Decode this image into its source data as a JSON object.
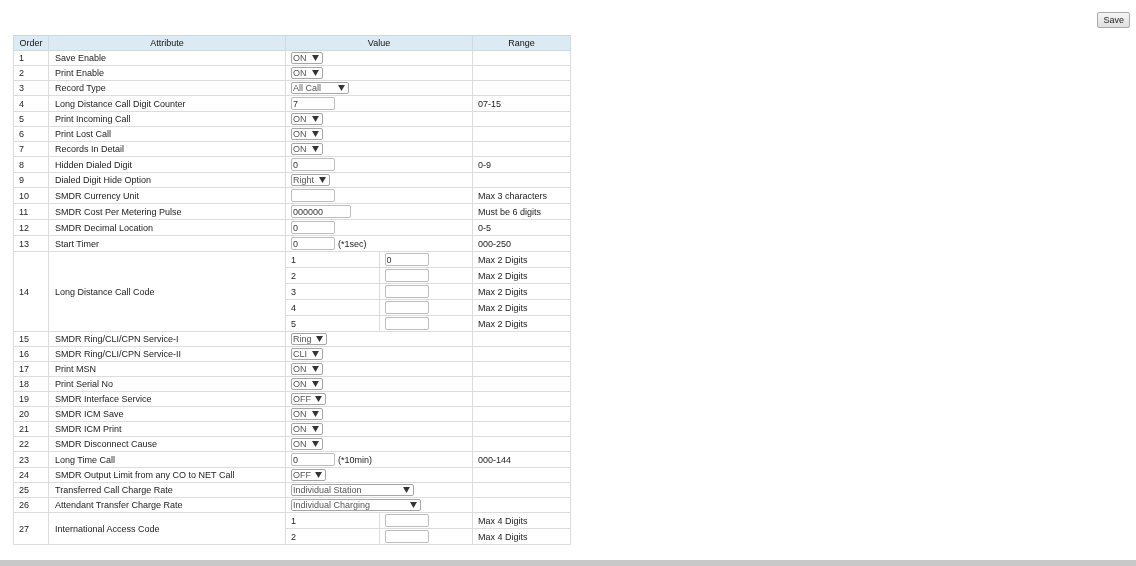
{
  "save_button": "Save",
  "columns": [
    "Order",
    "Attribute",
    "Value",
    "Range"
  ],
  "rows": [
    {
      "order": "1",
      "attribute": "Save Enable",
      "kind": "select",
      "value": "ON"
    },
    {
      "order": "2",
      "attribute": "Print Enable",
      "kind": "select",
      "value": "ON"
    },
    {
      "order": "3",
      "attribute": "Record Type",
      "kind": "select",
      "value": "All Call"
    },
    {
      "order": "4",
      "attribute": "Long Distance Call Digit Counter",
      "kind": "input",
      "value": "7",
      "range": "07-15"
    },
    {
      "order": "5",
      "attribute": "Print Incoming Call",
      "kind": "select",
      "value": "ON"
    },
    {
      "order": "6",
      "attribute": "Print Lost Call",
      "kind": "select",
      "value": "ON"
    },
    {
      "order": "7",
      "attribute": "Records In Detail",
      "kind": "select",
      "value": "ON"
    },
    {
      "order": "8",
      "attribute": "Hidden Dialed Digit",
      "kind": "input",
      "value": "0",
      "range": "0-9"
    },
    {
      "order": "9",
      "attribute": "Dialed Digit Hide Option",
      "kind": "select",
      "value": "Right"
    },
    {
      "order": "10",
      "attribute": "SMDR Currency Unit",
      "kind": "input",
      "range": "Max 3 characters"
    },
    {
      "order": "11",
      "attribute": "SMDR Cost Per Metering Pulse",
      "kind": "input",
      "value": "000000",
      "range": "Must be 6 digits"
    },
    {
      "order": "12",
      "attribute": "SMDR Decimal Location",
      "kind": "input",
      "value": "0",
      "range": "0-5"
    },
    {
      "order": "13",
      "attribute": "Start Timer",
      "kind": "input",
      "value": "0",
      "suffix": "(*1sec)",
      "range": "000-250"
    },
    {
      "order": "14",
      "attribute": "Long Distance Call Code",
      "kind": "multi",
      "entries": [
        {
          "index": "1",
          "value": "0",
          "range": "Max 2 Digits"
        },
        {
          "index": "2",
          "range": "Max 2 Digits"
        },
        {
          "index": "3",
          "range": "Max 2 Digits"
        },
        {
          "index": "4",
          "range": "Max 2 Digits"
        },
        {
          "index": "5",
          "range": "Max 2 Digits"
        }
      ]
    },
    {
      "order": "15",
      "attribute": "SMDR Ring/CLI/CPN Service-I",
      "kind": "select",
      "value": "Ring"
    },
    {
      "order": "16",
      "attribute": "SMDR Ring/CLI/CPN Service-II",
      "kind": "select",
      "value": "CLI"
    },
    {
      "order": "17",
      "attribute": "Print MSN",
      "kind": "select",
      "value": "ON"
    },
    {
      "order": "18",
      "attribute": "Print Serial No",
      "kind": "select",
      "value": "ON"
    },
    {
      "order": "19",
      "attribute": "SMDR Interface Service",
      "kind": "select",
      "value": "OFF"
    },
    {
      "order": "20",
      "attribute": "SMDR ICM Save",
      "kind": "select",
      "value": "ON"
    },
    {
      "order": "21",
      "attribute": "SMDR ICM Print",
      "kind": "select",
      "value": "ON"
    },
    {
      "order": "22",
      "attribute": "SMDR Disconnect Cause",
      "kind": "select",
      "value": "ON"
    },
    {
      "order": "23",
      "attribute": "Long Time Call",
      "kind": "input",
      "value": "0",
      "suffix": "(*10min)",
      "range": "000-144"
    },
    {
      "order": "24",
      "attribute": "SMDR Output Limit from any CO to NET Call",
      "kind": "select",
      "value": "OFF"
    },
    {
      "order": "25",
      "attribute": "Transferred Call Charge Rate",
      "kind": "select",
      "value": "Individual Station"
    },
    {
      "order": "26",
      "attribute": "Attendant Transfer Charge Rate",
      "kind": "select",
      "value": "Individual Charging"
    },
    {
      "order": "27",
      "attribute": "International Access Code",
      "kind": "multi",
      "entries": [
        {
          "index": "1",
          "range": "Max 4 Digits"
        },
        {
          "index": "2",
          "range": "Max 4 Digits"
        }
      ]
    }
  ]
}
